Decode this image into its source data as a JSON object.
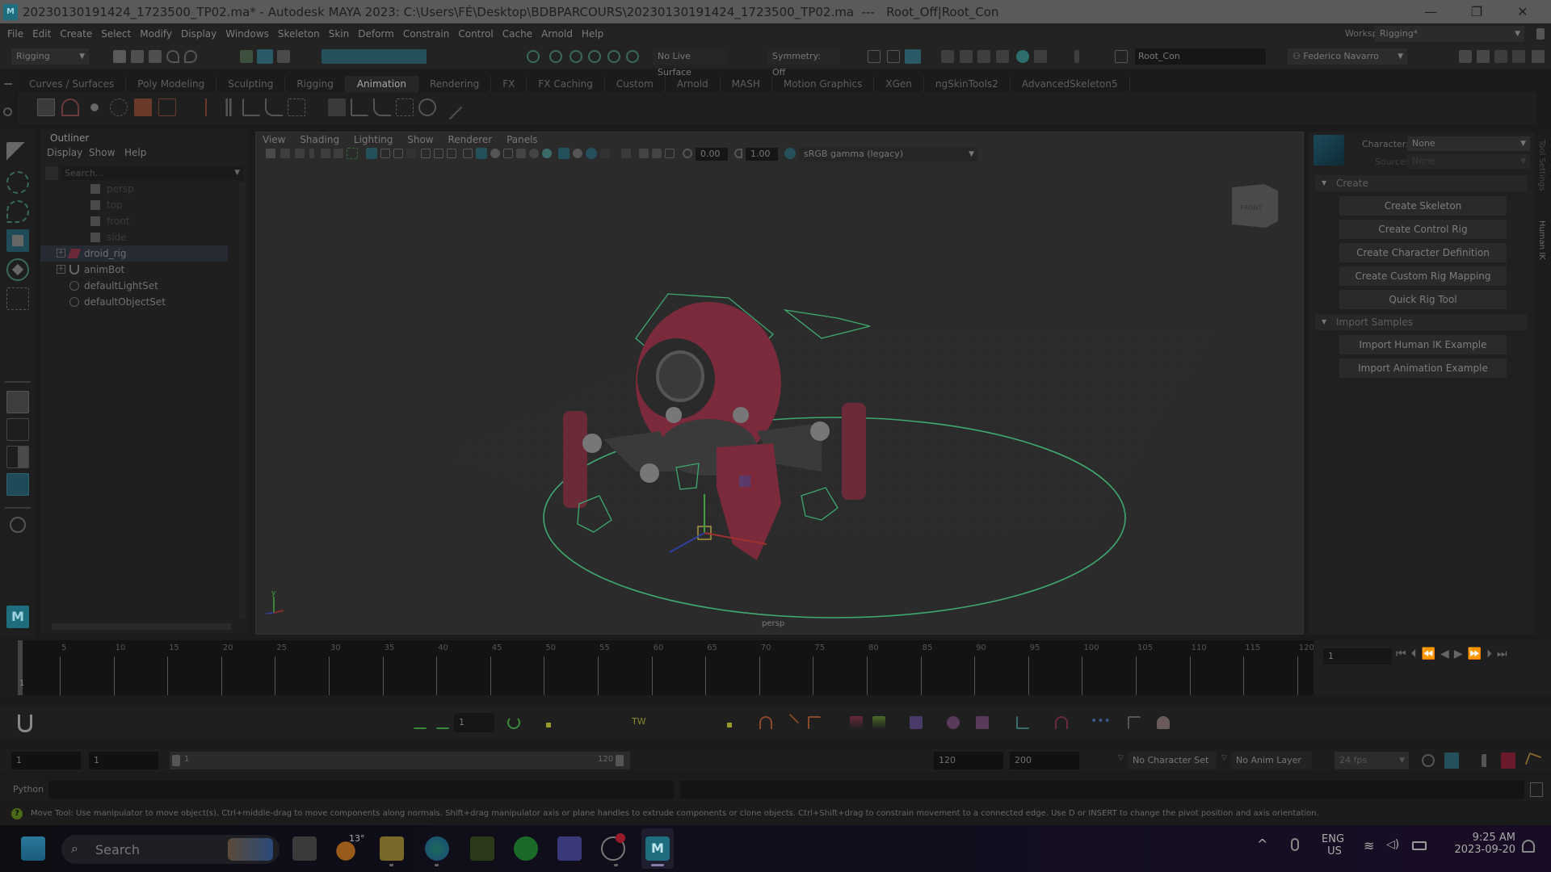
{
  "window": {
    "title": "20230130191424_1723500_TP02.ma* - Autodesk MAYA 2023: C:\\Users\\FÉ\\Desktop\\BDBPARCOURS\\20230130191424_1723500_TP02.ma  ---   Root_Off|Root_Con",
    "controls": {
      "minimize": "—",
      "restore": "❐",
      "close": "✕"
    }
  },
  "menubar": {
    "items": [
      "File",
      "Edit",
      "Create",
      "Select",
      "Modify",
      "Display",
      "Windows",
      "Skeleton",
      "Skin",
      "Deform",
      "Constrain",
      "Control",
      "Cache",
      "Arnold",
      "Help"
    ],
    "workspace_label": "Workspace:",
    "workspace_value": "Rigging*"
  },
  "statusline": {
    "menuset": "Rigging",
    "live_surface": "No Live Surface",
    "symmetry": "Symmetry: Off",
    "selection_field": "Root_Con",
    "user": "Federico Navarro"
  },
  "shelf": {
    "tabs": [
      "Curves / Surfaces",
      "Poly Modeling",
      "Sculpting",
      "Rigging",
      "Animation",
      "Rendering",
      "FX",
      "FX Caching",
      "Custom",
      "Arnold",
      "MASH",
      "Motion Graphics",
      "XGen",
      "ngSkinTools2",
      "AdvancedSkeleton5"
    ],
    "active_tab": "Animation"
  },
  "outliner": {
    "title": "Outliner",
    "menu": [
      "Display",
      "Show",
      "Help"
    ],
    "search_placeholder": "Search...",
    "items": [
      {
        "label": "persp",
        "type": "camera",
        "dim": true
      },
      {
        "label": "top",
        "type": "camera",
        "dim": true
      },
      {
        "label": "front",
        "type": "camera",
        "dim": true
      },
      {
        "label": "side",
        "type": "camera",
        "dim": true
      },
      {
        "label": "droid_rig",
        "type": "transform",
        "expandable": true,
        "selected": true
      },
      {
        "label": "animBot",
        "type": "animbot",
        "expandable": true
      },
      {
        "label": "defaultLightSet",
        "type": "set"
      },
      {
        "label": "defaultObjectSet",
        "type": "set"
      }
    ]
  },
  "viewport": {
    "menu": [
      "View",
      "Shading",
      "Lighting",
      "Show",
      "Renderer",
      "Panels"
    ],
    "near_value": "0.00",
    "exposure_value": "1.00",
    "color_space": "sRGB gamma (legacy)",
    "camera_label": "persp",
    "viewcube_label": "FRONT",
    "axis_labels": {
      "y": "y",
      "z": "z",
      "x": "x"
    }
  },
  "humanik": {
    "character_label": "Character:",
    "character_value": "None",
    "source_label": "Source:",
    "source_value": "None",
    "create_section": "Create",
    "create_buttons": [
      "Create Skeleton",
      "Create Control Rig",
      "Create Character Definition",
      "Create Custom Rig Mapping",
      "Quick Rig Tool"
    ],
    "import_section": "Import Samples",
    "import_buttons": [
      "Import Human IK Example",
      "Import Animation Example"
    ],
    "side_tabs": [
      "Tool Settings",
      "Human IK"
    ]
  },
  "timeline": {
    "ticks": [
      "5",
      "10",
      "15",
      "20",
      "25",
      "30",
      "35",
      "40",
      "45",
      "50",
      "55",
      "60",
      "65",
      "70",
      "75",
      "80",
      "85",
      "90",
      "95",
      "100",
      "105",
      "110",
      "115",
      "120"
    ],
    "current_frame_marker": "1",
    "current_frame_field": "1"
  },
  "animbar": {
    "frame_field": "1",
    "tween_label": "TW"
  },
  "range": {
    "start": "1",
    "playback_start": "1",
    "slider_start": "1",
    "slider_end": "120",
    "playback_end": "120",
    "end": "200",
    "character_set": "No Character Set",
    "anim_layer": "No Anim Layer",
    "fps": "24 fps"
  },
  "command_line": {
    "language": "Python"
  },
  "help_line": {
    "text": "Move Tool: Use manipulator to move object(s). Ctrl+middle-drag to move components along normals. Shift+drag manipulator axis or plane handles to extrude components or clone objects. Ctrl+Shift+drag to constrain movement to a connected edge. Use D or INSERT to change the pivot position and axis orientation."
  },
  "taskbar": {
    "search_placeholder": "Search",
    "weather_temp": "13°",
    "lang_line1": "ENG",
    "lang_line2": "US",
    "time": "9:25 AM",
    "date": "2023-09-20",
    "maya_label": "M"
  },
  "colors": {
    "accent_teal": "#2a6a7c",
    "selection_green": "#3fa870",
    "robot_red": "#7a2a3a"
  }
}
